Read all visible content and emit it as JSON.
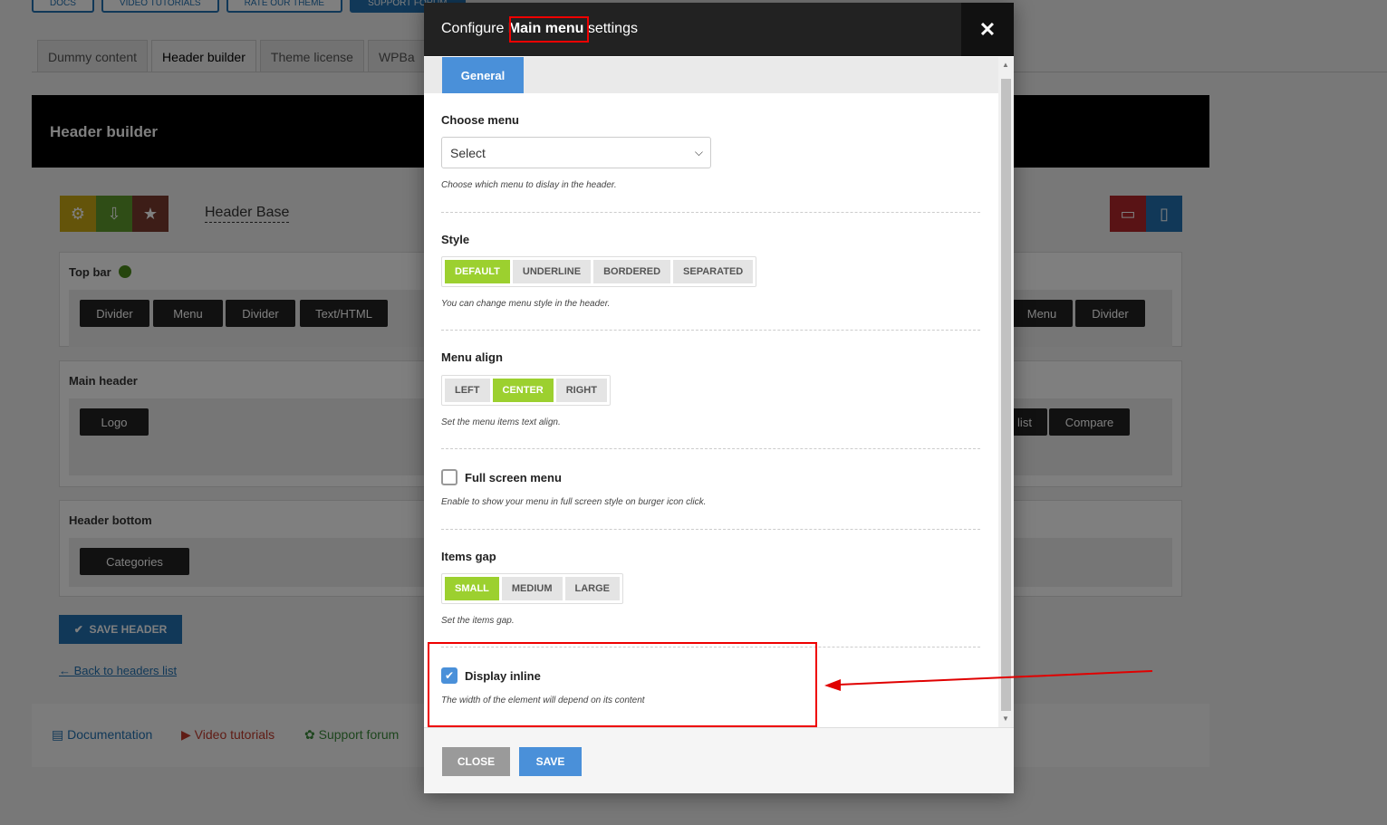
{
  "background": {
    "top_buttons": [
      "DOCS",
      "VIDEO TUTORIALS",
      "RATE OUR THEME",
      "SUPPORT FORUM"
    ],
    "tabs": [
      "Dummy content",
      "Header builder",
      "Theme license",
      "WPBa"
    ],
    "active_tab": "Header builder",
    "panel_title": "Header builder",
    "header_base_title": "Header Base",
    "rows": {
      "top_bar": {
        "label": "Top bar",
        "left_elements": [
          "Divider",
          "Menu",
          "Divider",
          "Text/HTML"
        ],
        "right_elements": [
          "Menu",
          "Divider"
        ]
      },
      "main_header": {
        "label": "Main header",
        "left_elements": [
          "Logo"
        ],
        "right_elements": [
          "list",
          "Compare"
        ]
      },
      "header_bottom": {
        "label": "Header bottom",
        "left_elements": [
          "Categories"
        ]
      }
    },
    "save_header_label": "SAVE HEADER",
    "back_link": "← Back to headers list",
    "footer_links": [
      "Documentation",
      "Video tutorials",
      "Support forum"
    ]
  },
  "modal": {
    "title_prefix": "Configure ",
    "title_highlight": "Main menu",
    "title_suffix": " settings",
    "close_symbol": "✕",
    "tab_general": "General",
    "choose_menu": {
      "label": "Choose menu",
      "value": "Select",
      "help": "Choose which menu to dislay in the header."
    },
    "style": {
      "label": "Style",
      "options": [
        "DEFAULT",
        "UNDERLINE",
        "BORDERED",
        "SEPARATED"
      ],
      "selected": "DEFAULT",
      "help": "You can change menu style in the header."
    },
    "menu_align": {
      "label": "Menu align",
      "options": [
        "LEFT",
        "CENTER",
        "RIGHT"
      ],
      "selected": "CENTER",
      "help": "Set the menu items text align."
    },
    "full_screen": {
      "label": "Full screen menu",
      "checked": false,
      "help": "Enable to show your menu in full screen style on burger icon click."
    },
    "items_gap": {
      "label": "Items gap",
      "options": [
        "SMALL",
        "MEDIUM",
        "LARGE"
      ],
      "selected": "SMALL",
      "help": "Set the items gap."
    },
    "display_inline": {
      "label": "Display inline",
      "checked": true,
      "help": "The width of the element will depend on its content"
    },
    "close_label": "CLOSE",
    "save_label": "SAVE"
  },
  "colors": {
    "accent_blue": "#4a90d9",
    "active_green": "#9cd02f",
    "annotation_red": "#e00000"
  }
}
